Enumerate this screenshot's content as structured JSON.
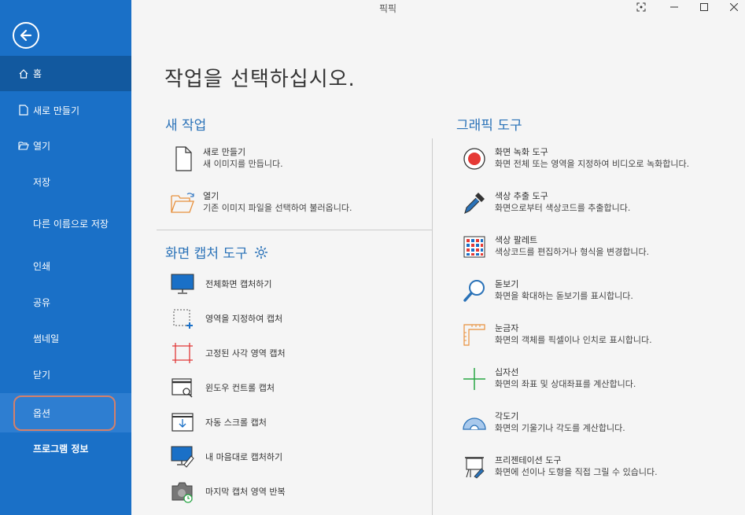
{
  "app": {
    "title": "픽픽"
  },
  "sidebar": {
    "home": "홈",
    "new": "새로 만들기",
    "open": "열기",
    "save": "저장",
    "save_as": "다른 이름으로 저장",
    "print": "인쇄",
    "share": "공유",
    "thumbnail": "썸네일",
    "close": "닫기",
    "options": "옵션",
    "about": "프로그램 정보"
  },
  "main": {
    "title": "작업을 선택하십시오.",
    "new_work": {
      "title": "새 작업",
      "items": [
        {
          "title": "새로 만들기",
          "desc": "새 이미지를 만듭니다."
        },
        {
          "title": "열기",
          "desc": "기존 이미지 파일을 선택하여 불러옵니다."
        }
      ]
    },
    "capture": {
      "title": "화면 캡처 도구",
      "items": [
        {
          "label": "전체화면 캡처하기"
        },
        {
          "label": "영역을 지정하여 캡처"
        },
        {
          "label": "고정된 사각 영역 캡처"
        },
        {
          "label": "윈도우 컨트롤 캡처"
        },
        {
          "label": "자동 스크롤 캡처"
        },
        {
          "label": "내 마음대로 캡처하기"
        },
        {
          "label": "마지막 캡처 영역 반복"
        }
      ]
    },
    "graphic": {
      "title": "그래픽 도구",
      "items": [
        {
          "title": "화면 녹화 도구",
          "desc": "화면 전체 또는 영역을 지정하여 비디오로 녹화합니다."
        },
        {
          "title": "색상 추출 도구",
          "desc": "화면으로부터 색상코드를 추출합니다."
        },
        {
          "title": "색상 팔레트",
          "desc": "색상코드를 편집하거나 형식을 변경합니다."
        },
        {
          "title": "돋보기",
          "desc": "화면을 확대하는 돋보기를 표시합니다."
        },
        {
          "title": "눈금자",
          "desc": "화면의 객체를 픽셀이나 인치로 표시합니다."
        },
        {
          "title": "십자선",
          "desc": "화면의 좌표 및 상대좌표를 계산합니다."
        },
        {
          "title": "각도기",
          "desc": "화면의 기울기나 각도를 계산합니다."
        },
        {
          "title": "프리젠테이션 도구",
          "desc": "화면에 선이나 도형을 직접 그릴 수 있습니다."
        }
      ]
    }
  },
  "colors": {
    "sidebar": "#1a70c7",
    "sidebar_selected": "#12599f",
    "accent": "#2a72b8",
    "options_highlight": "#d4806a"
  }
}
